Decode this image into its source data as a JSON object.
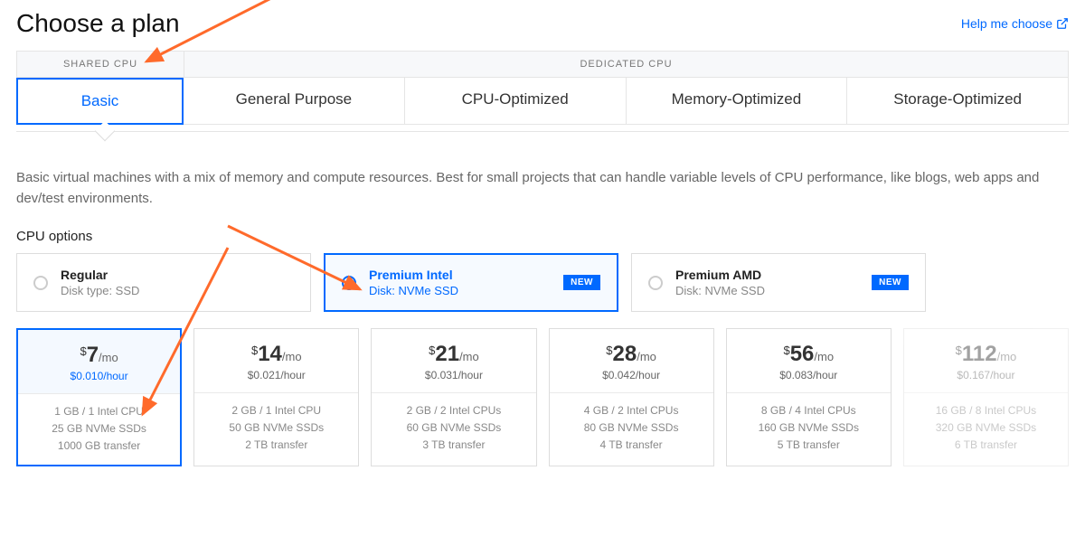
{
  "title": "Choose a plan",
  "help_link": "Help me choose",
  "cpu_headers": {
    "shared": "SHARED CPU",
    "dedicated": "DEDICATED CPU"
  },
  "plan_tabs": [
    "Basic",
    "General Purpose",
    "CPU-Optimized",
    "Memory-Optimized",
    "Storage-Optimized"
  ],
  "description": "Basic virtual machines with a mix of memory and compute resources. Best for small projects that can handle variable levels of CPU performance, like blogs, web apps and dev/test environments.",
  "cpu_options_label": "CPU options",
  "cpu_options": [
    {
      "name": "Regular",
      "disk": "Disk type: SSD",
      "is_new": false,
      "selected": false
    },
    {
      "name": "Premium Intel",
      "disk": "Disk: NVMe SSD",
      "is_new": true,
      "selected": true
    },
    {
      "name": "Premium AMD",
      "disk": "Disk: NVMe SSD",
      "is_new": true,
      "selected": false
    }
  ],
  "new_label": "NEW",
  "price_cards": [
    {
      "price": "7",
      "hour": "$0.010/hour",
      "spec1": "1 GB / 1 Intel CPU",
      "spec2": "25 GB NVMe SSDs",
      "spec3": "1000 GB transfer",
      "selected": true,
      "disabled": false
    },
    {
      "price": "14",
      "hour": "$0.021/hour",
      "spec1": "2 GB / 1 Intel CPU",
      "spec2": "50 GB NVMe SSDs",
      "spec3": "2 TB transfer",
      "selected": false,
      "disabled": false
    },
    {
      "price": "21",
      "hour": "$0.031/hour",
      "spec1": "2 GB / 2 Intel CPUs",
      "spec2": "60 GB NVMe SSDs",
      "spec3": "3 TB transfer",
      "selected": false,
      "disabled": false
    },
    {
      "price": "28",
      "hour": "$0.042/hour",
      "spec1": "4 GB / 2 Intel CPUs",
      "spec2": "80 GB NVMe SSDs",
      "spec3": "4 TB transfer",
      "selected": false,
      "disabled": false
    },
    {
      "price": "56",
      "hour": "$0.083/hour",
      "spec1": "8 GB / 4 Intel CPUs",
      "spec2": "160 GB NVMe SSDs",
      "spec3": "5 TB transfer",
      "selected": false,
      "disabled": false
    },
    {
      "price": "112",
      "hour": "$0.167/hour",
      "spec1": "16 GB / 8 Intel CPUs",
      "spec2": "320 GB NVMe SSDs",
      "spec3": "6 TB transfer",
      "selected": false,
      "disabled": true
    }
  ],
  "per_mo": "/mo"
}
